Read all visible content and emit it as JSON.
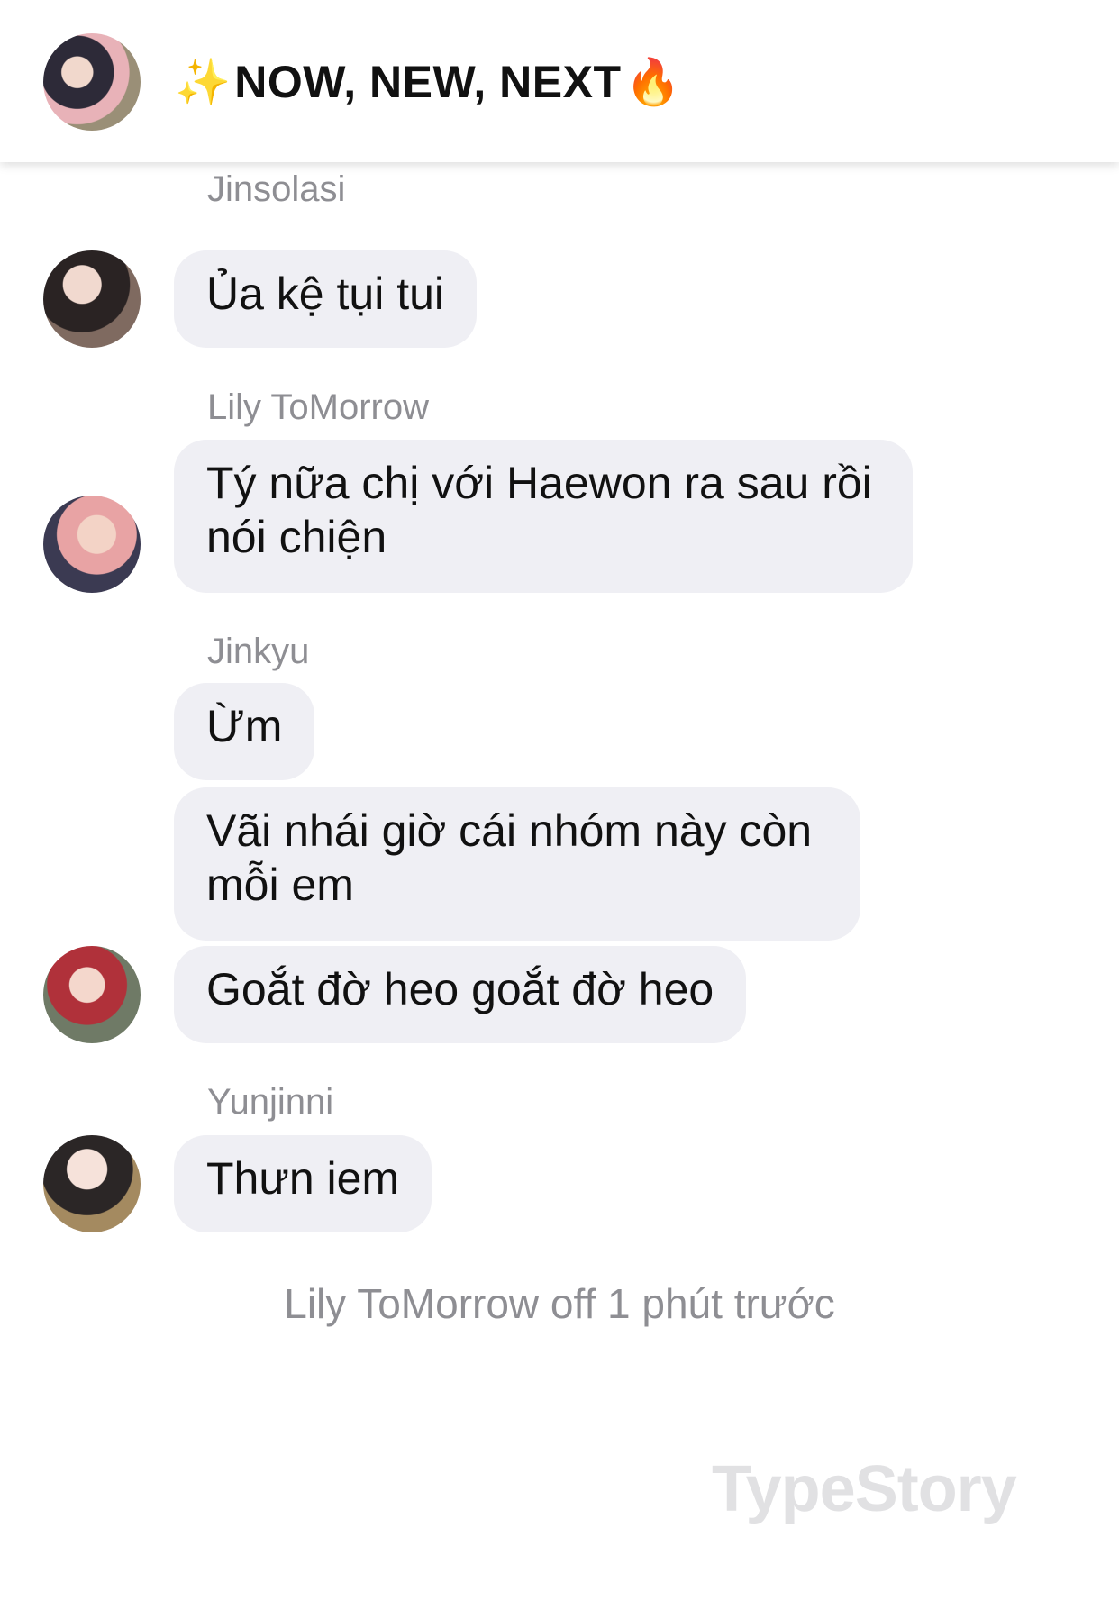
{
  "header": {
    "title": "NOW, NEW, NEXT",
    "leading_emoji": "✨",
    "trailing_emoji": "🔥"
  },
  "messages": [
    {
      "sender": "Jinsolasi",
      "bubbles": [
        "Ủa kệ tụi tui"
      ]
    },
    {
      "sender": "Lily ToMorrow",
      "bubbles": [
        "Tý nữa chị với Haewon ra sau rồi\nnói chiện"
      ]
    },
    {
      "sender": "Jinkyu",
      "bubbles": [
        "Ừm",
        "Vãi nhái giờ cái nhóm này còn\nmỗi em",
        "Goắt đờ heo goắt đờ heo"
      ]
    },
    {
      "sender": "Yunjinni",
      "bubbles": [
        "Thưn iem"
      ]
    }
  ],
  "status": "Lily ToMorrow off 1 phút trước",
  "watermark": "TypeStory",
  "colors": {
    "bubble": "#efeff4",
    "sender_text": "#8e8e93",
    "message_text": "#111111"
  }
}
